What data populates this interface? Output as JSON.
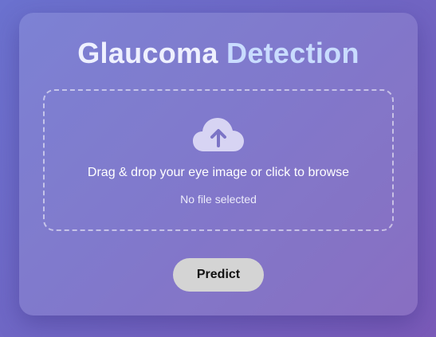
{
  "header": {
    "title_part1": "Glaucoma",
    "title_part2": "Detection"
  },
  "upload": {
    "icon": "cloud-upload-icon",
    "prompt": "Drag & drop your eye image or click to browse",
    "file_status": "No file selected"
  },
  "actions": {
    "predict_label": "Predict"
  },
  "colors": {
    "title_primary": "#eef0ff",
    "title_accent": "#c9dcff",
    "icon": "#d7d4f3",
    "button_bg": "#d4d4d4"
  }
}
